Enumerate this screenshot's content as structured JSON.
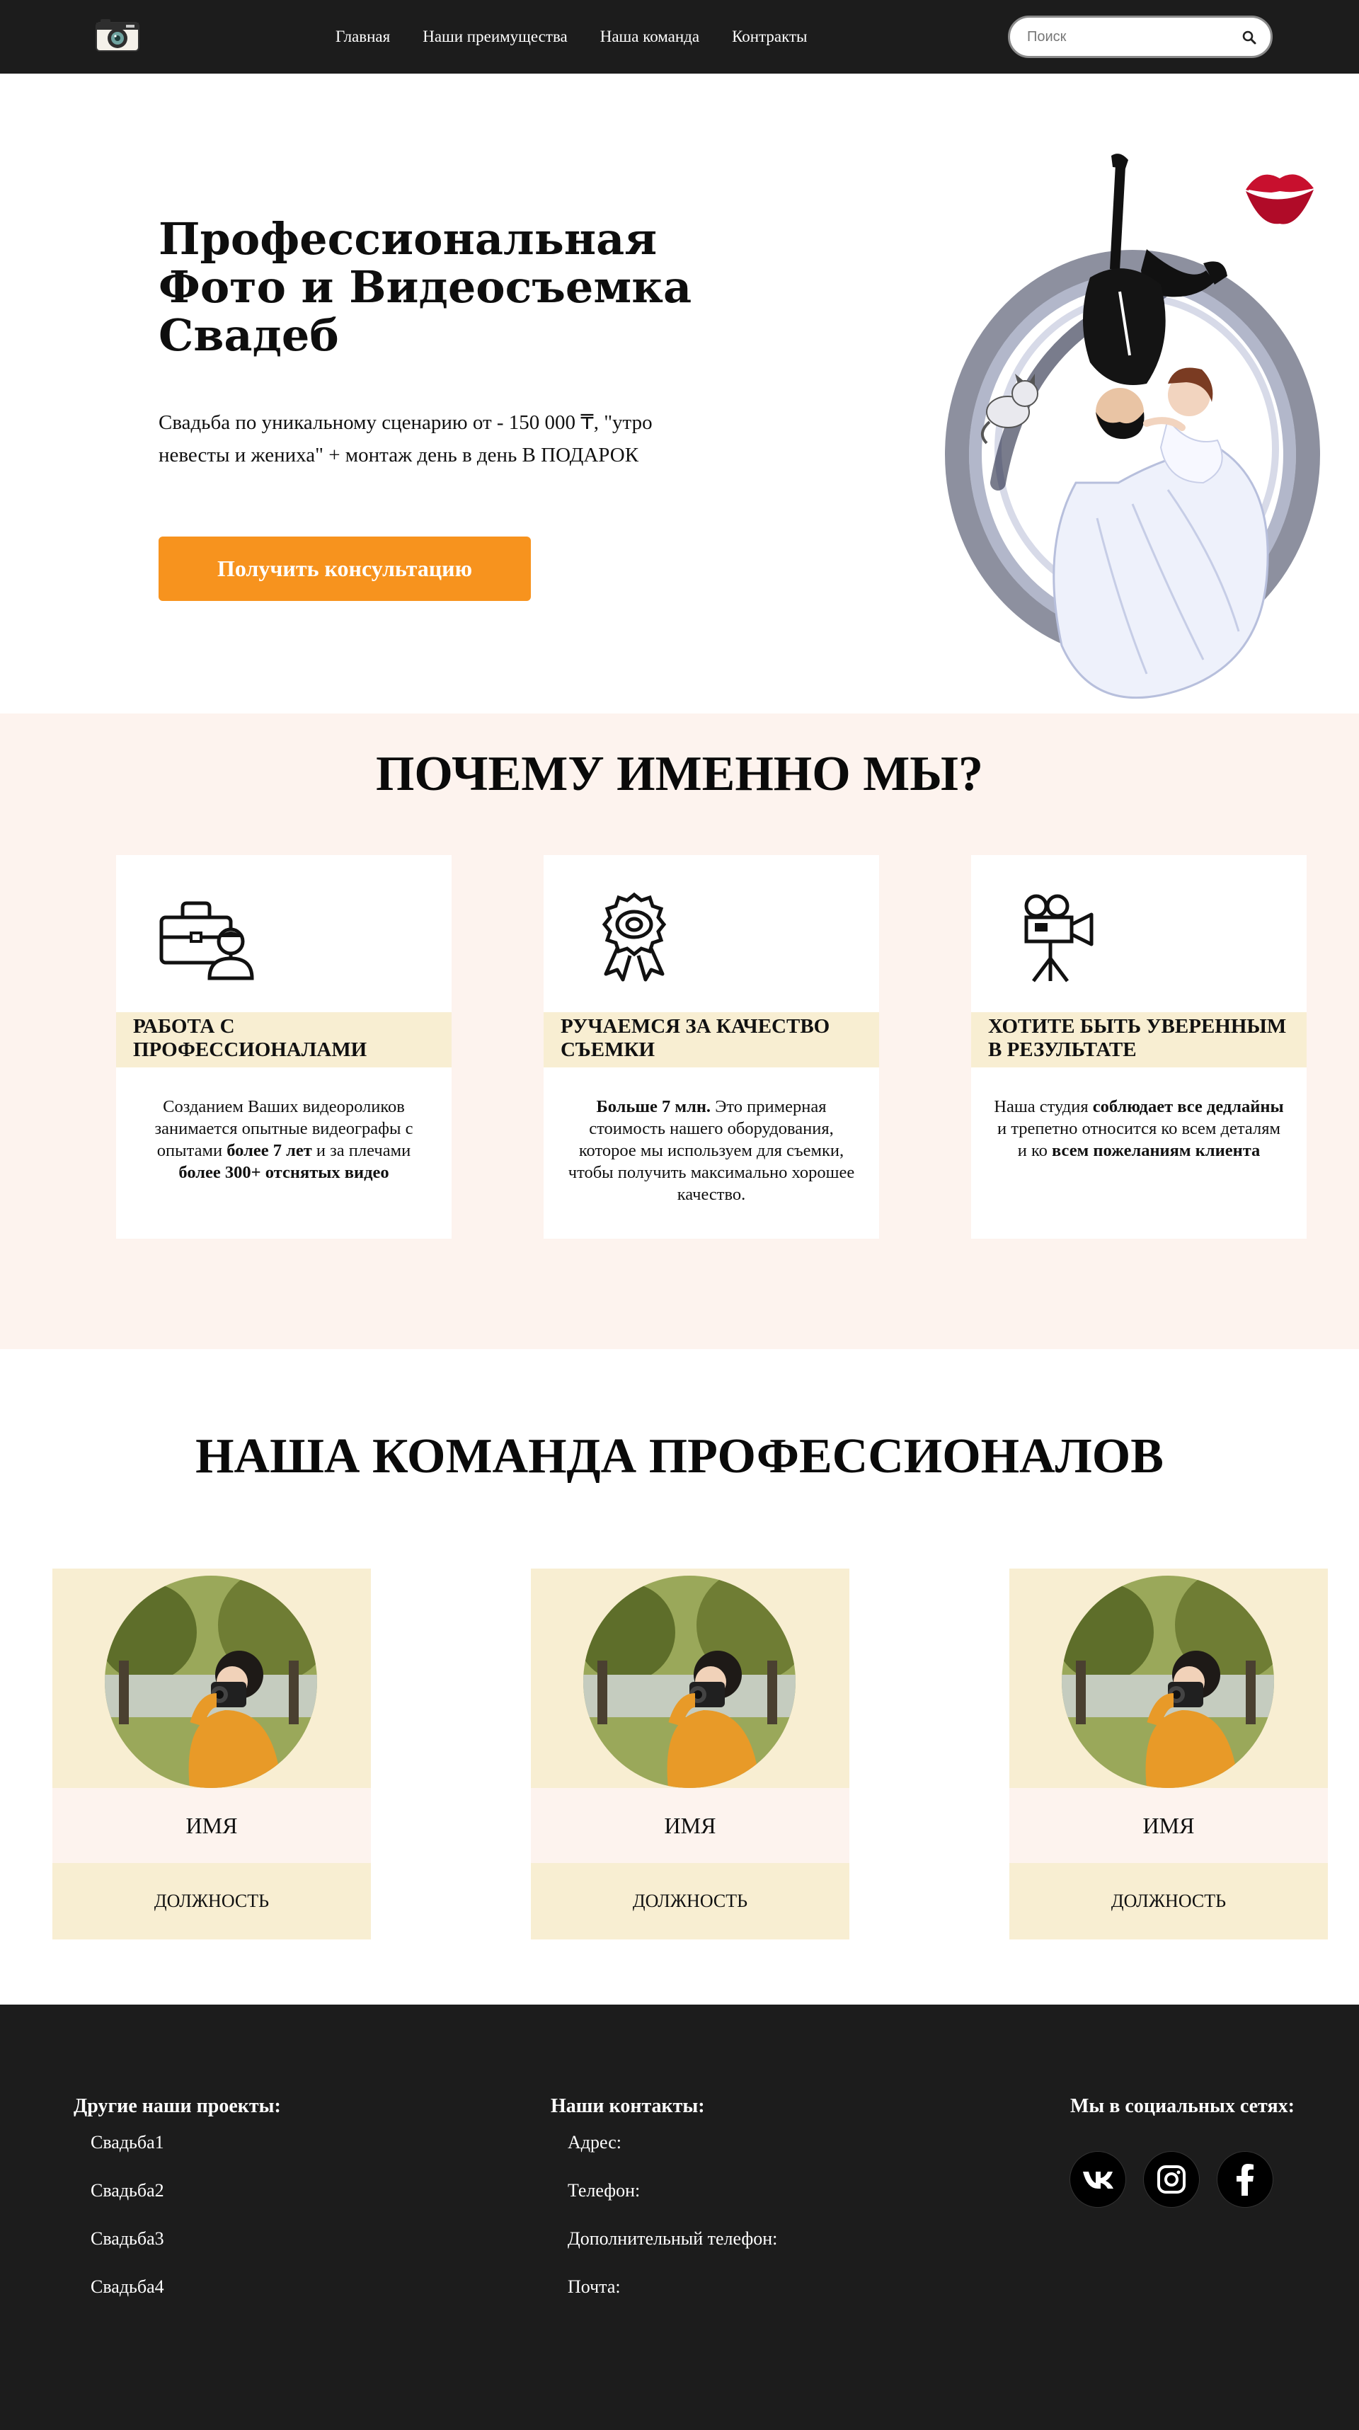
{
  "header": {
    "logo_icon": "camera-icon",
    "nav": [
      {
        "label": "Главная"
      },
      {
        "label": "Наши преимущества"
      },
      {
        "label": "Наша команда"
      },
      {
        "label": "Контракты"
      }
    ],
    "search": {
      "placeholder": "Поиск",
      "icon": "search-icon"
    }
  },
  "hero": {
    "title": "Профессиональная Фото и Видеосъемка Свадеб",
    "text": "Свадьба по уникальному сценарию от - 150 000 ₸, \"утро невесты и жениха\" + монтаж день в день В ПОДАРОК",
    "cta": "Получить консультацию",
    "accent_color": "#f7931e"
  },
  "advantages": {
    "title": "ПОЧЕМУ ИМЕННО МЫ?",
    "cards": [
      {
        "icon": "professional-icon",
        "title": "РАБОТА С ПРОФЕССИОНАЛАМИ",
        "desc_1": "Созданием Ваших видеороликов занимается опытные видеографы с опытами ",
        "bold_1": "более 7 лет",
        "desc_2": " и за плечами ",
        "bold_2": "более 300+ отснятых видео"
      },
      {
        "icon": "award-icon",
        "title": "РУЧАЕМСЯ ЗА КАЧЕСТВО СЪЕМКИ",
        "bold_1": "Больше 7 млн.",
        "desc_1": " Это примерная стоимость нашего оборудования, которое мы используем для съемки, чтобы получить максимально хорошее качество."
      },
      {
        "icon": "video-camera-icon",
        "title": "ХОТИТЕ БЫТЬ УВЕРЕННЫМ В РЕЗУЛЬТАТЕ",
        "desc_1": "Наша студия ",
        "bold_1": "соблюдает все дедлайны",
        "desc_2": " и трепетно относится ко всем деталям и ко ",
        "bold_2": "всем пожеланиям клиента"
      }
    ]
  },
  "team": {
    "title": "НАША КОМАНДА ПРОФЕССИОНАЛОВ",
    "members": [
      {
        "name": "ИМЯ",
        "role": "ДОЛЖНОСТЬ"
      },
      {
        "name": "ИМЯ",
        "role": "ДОЛЖНОСТЬ"
      },
      {
        "name": "ИМЯ",
        "role": "ДОЛЖНОСТЬ"
      }
    ]
  },
  "footer": {
    "projects": {
      "title": "Другие наши проекты:",
      "items": [
        "Свадьба1",
        "Свадьба2",
        "Свадьба3",
        "Свадьба4"
      ]
    },
    "contacts": {
      "title": "Наши контакты:",
      "items": [
        "Адрес:",
        "Телефон:",
        "Дополнительный телефон:",
        "Почта:"
      ]
    },
    "social": {
      "title": "Мы в социальных сетях:",
      "icons": [
        "vk-icon",
        "instagram-icon",
        "facebook-icon"
      ]
    }
  },
  "colors": {
    "dark": "#1c1c1c",
    "cream": "#f8eed2",
    "blush": "#fdf3ee"
  }
}
